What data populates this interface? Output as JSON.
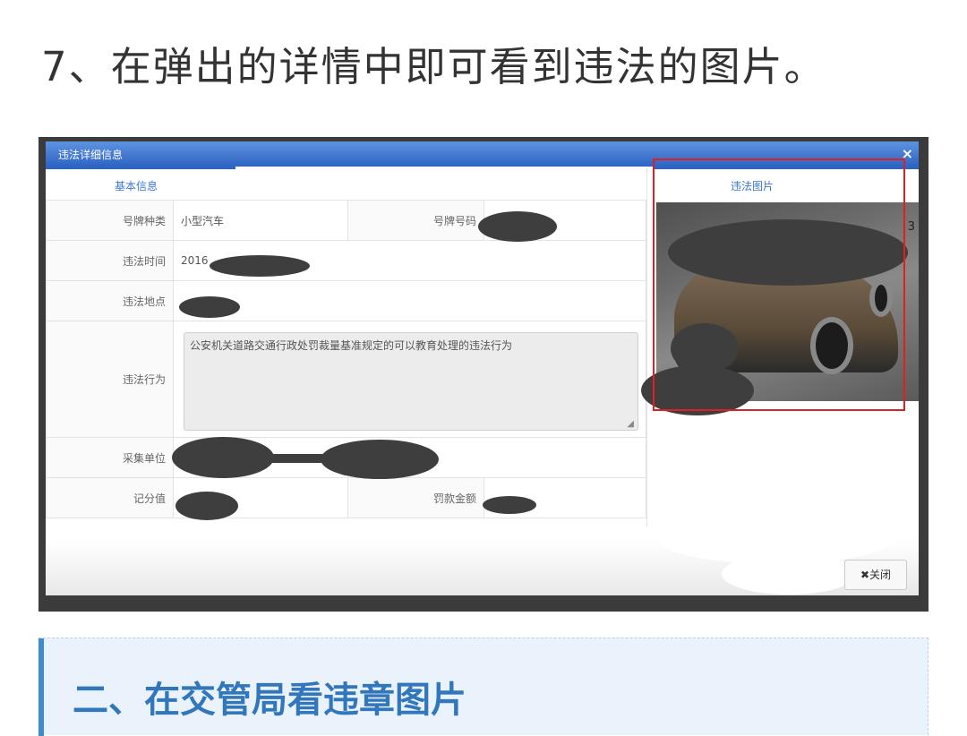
{
  "step_title": "7、在弹出的详情中即可看到违法的图片。",
  "modal": {
    "title": "违法详细信息",
    "close_x": "×",
    "tab_basic": "基本信息",
    "tab_photo": "违法图片",
    "photo_number": "3",
    "fields": {
      "plate_type_label": "号牌种类",
      "plate_type_value": "小型汽车",
      "plate_number_label": "号牌号码",
      "time_label": "违法时间",
      "time_value": "2016",
      "place_label": "违法地点",
      "act_label": "违法行为",
      "act_value": "公安机关道路交通行政处罚裁量基准规定的可以教育处理的违法行为",
      "unit_label": "采集单位",
      "points_label": "记分值",
      "fine_label": "罚款金额"
    },
    "close_button": "✖关闭"
  },
  "section_title": "二、在交管局看违章图片"
}
